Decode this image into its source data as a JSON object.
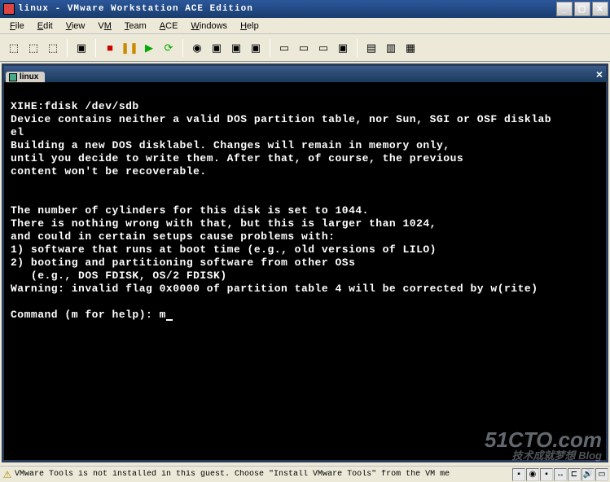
{
  "window": {
    "title": "linux - VMware Workstation ACE Edition"
  },
  "menu": {
    "items": [
      {
        "label": "File",
        "key": "F"
      },
      {
        "label": "Edit",
        "key": "E"
      },
      {
        "label": "View",
        "key": "V"
      },
      {
        "label": "VM",
        "key": "M"
      },
      {
        "label": "Team",
        "key": "T"
      },
      {
        "label": "ACE",
        "key": "A"
      },
      {
        "label": "Windows",
        "key": "W"
      },
      {
        "label": "Help",
        "key": "H"
      }
    ]
  },
  "toolbar_icons": {
    "power_off": "power-off-icon",
    "suspend": "suspend-icon",
    "revert": "revert-icon",
    "screenshot": "screenshot-icon",
    "stop": "stop-icon",
    "pause": "pause-icon",
    "play": "play-icon",
    "cycle": "cycle-icon",
    "snapshot": "snapshot-icon",
    "snapshot_mgr1": "snapshot-manager-icon",
    "snapshot_mgr2": "snapshot-revert-icon",
    "snapshot_mgr3": "snapshot-take-icon",
    "fullscreen1": "fullscreen-icon",
    "unity": "unity-icon",
    "console": "console-view-icon",
    "appliance": "appliance-view-icon",
    "show1": "show-sidebar-icon",
    "show2": "show-toolbar-icon",
    "show3": "quick-switch-icon"
  },
  "tab": {
    "label": "linux"
  },
  "terminal": {
    "lines": [
      "XIHE:fdisk /dev/sdb",
      "Device contains neither a valid DOS partition table, nor Sun, SGI or OSF disklab",
      "el",
      "Building a new DOS disklabel. Changes will remain in memory only,",
      "until you decide to write them. After that, of course, the previous",
      "content won't be recoverable.",
      "",
      "",
      "The number of cylinders for this disk is set to 1044.",
      "There is nothing wrong with that, but this is larger than 1024,",
      "and could in certain setups cause problems with:",
      "1) software that runs at boot time (e.g., old versions of LILO)",
      "2) booting and partitioning software from other OSs",
      "   (e.g., DOS FDISK, OS/2 FDISK)",
      "Warning: invalid flag 0x0000 of partition table 4 will be corrected by w(rite)",
      "",
      "Command (m for help): m"
    ]
  },
  "status": {
    "text": "VMware Tools is not installed in this guest. Choose \"Install VMware Tools\" from the VM me"
  },
  "watermark": {
    "main": "51CTO.com",
    "sub": "技术成就梦想   Blog"
  }
}
